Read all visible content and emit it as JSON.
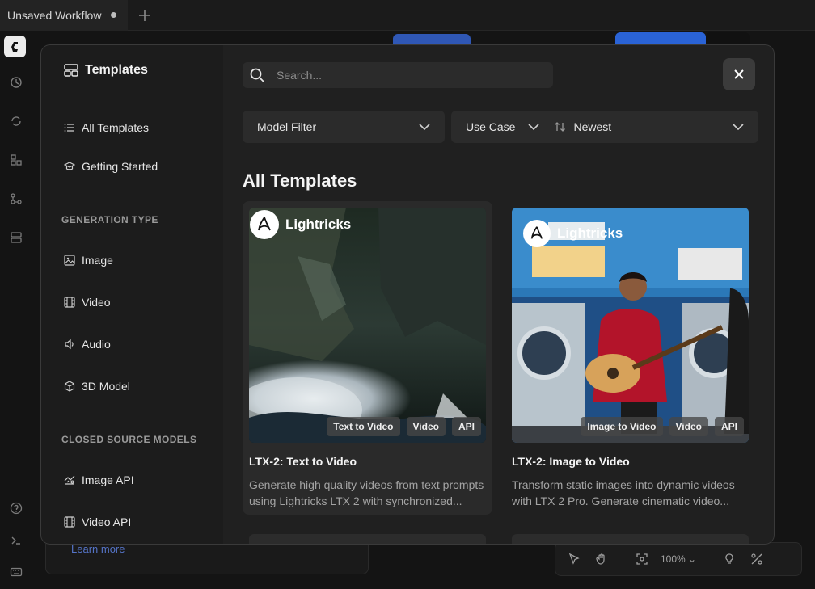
{
  "app": {
    "tab_title": "Unsaved Workflow",
    "learn_more": "Learn more",
    "zoom": "100%"
  },
  "modal": {
    "sidebar": {
      "title": "Templates",
      "items": [
        {
          "label": "All Templates",
          "icon": "list-icon"
        },
        {
          "label": "Getting Started",
          "icon": "graduation-cap-icon"
        }
      ],
      "sections": [
        {
          "title": "GENERATION TYPE",
          "items": [
            {
              "label": "Image",
              "icon": "image-icon"
            },
            {
              "label": "Video",
              "icon": "film-icon"
            },
            {
              "label": "Audio",
              "icon": "volume-icon"
            },
            {
              "label": "3D Model",
              "icon": "cube-icon"
            }
          ]
        },
        {
          "title": "CLOSED SOURCE MODELS",
          "items": [
            {
              "label": "Image API",
              "icon": "image-api-icon"
            },
            {
              "label": "Video API",
              "icon": "film-icon"
            }
          ]
        }
      ]
    },
    "search": {
      "placeholder": "Search..."
    },
    "filters": {
      "model": "Model Filter",
      "use_case": "Use Case",
      "sort": "Newest"
    },
    "heading": "All Templates",
    "cards": [
      {
        "brand": "Lightricks",
        "tags": [
          "Text to Video",
          "Video",
          "API"
        ],
        "title": "LTX-2: Text to Video",
        "desc_line1": "Generate high quality videos from text prompts",
        "desc_line2": "using Lightricks LTX 2 with synchronized..."
      },
      {
        "brand": "Lightricks",
        "tags": [
          "Image to Video",
          "Video",
          "API"
        ],
        "title": "LTX-2: Image to Video",
        "desc_line1": "Transform static images into dynamic videos",
        "desc_line2": "with LTX 2 Pro. Generate cinematic video..."
      }
    ]
  },
  "colors": {
    "accent": "#2a63d6",
    "modal_bg": "#202020",
    "sidebar_bg": "#1c1c1c"
  }
}
